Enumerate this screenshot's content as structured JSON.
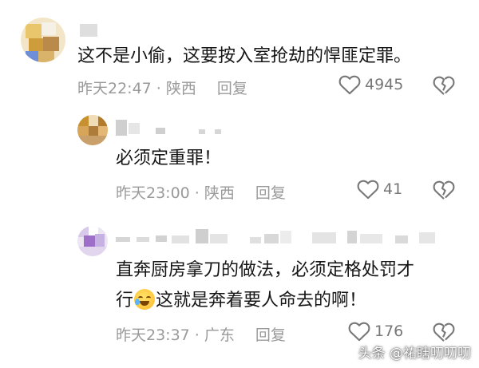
{
  "comments": [
    {
      "text_lines": [
        "这不是小偷，这要按入室抢劫的悍匪定罪。"
      ],
      "time": "昨天22:47",
      "location": "陕西",
      "reply_label": "回复",
      "likes": "4945",
      "like_icon": "heart-outline-icon",
      "dislike_icon": "broken-heart-icon"
    },
    {
      "text_lines": [
        "必须定重罪！"
      ],
      "time": "昨天23:00",
      "location": "陕西",
      "reply_label": "回复",
      "likes": "41",
      "like_icon": "heart-outline-icon",
      "dislike_icon": "broken-heart-icon"
    },
    {
      "text_lines": [
        "直奔厨房拿刀的做法，必须定格处罚才",
        "这就是奔着要人命去的啊！"
      ],
      "text_line2_prefix": "行",
      "emoji": "tears-of-joy-emoji",
      "time": "昨天23:37",
      "location": "广东",
      "reply_label": "回复",
      "likes": "176",
      "like_icon": "heart-outline-icon",
      "dislike_icon": "broken-heart-icon"
    }
  ],
  "watermark": "头条 @祐瞎叨叨叨",
  "colors": {
    "text": "#161616",
    "meta": "#9a9a9a",
    "background": "#ffffff"
  }
}
